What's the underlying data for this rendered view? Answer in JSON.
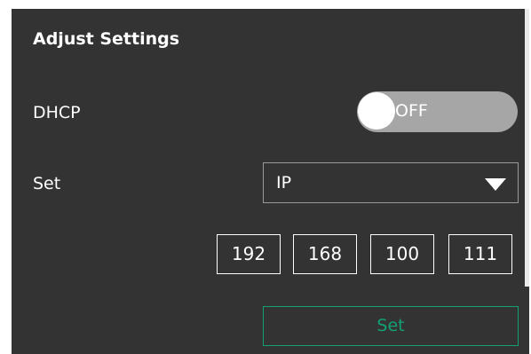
{
  "panel": {
    "title": "Adjust Settings"
  },
  "dhcp": {
    "label": "DHCP",
    "toggle_state": "OFF"
  },
  "set_row": {
    "label": "Set",
    "selected_option": "IP"
  },
  "ip_address": {
    "octets": [
      "192",
      "168",
      "100",
      "111"
    ]
  },
  "actions": {
    "set_label": "Set"
  },
  "colors": {
    "panel_bg": "#333333",
    "toggle_off": "#a6a6a6",
    "accent_green": "#13a074"
  }
}
